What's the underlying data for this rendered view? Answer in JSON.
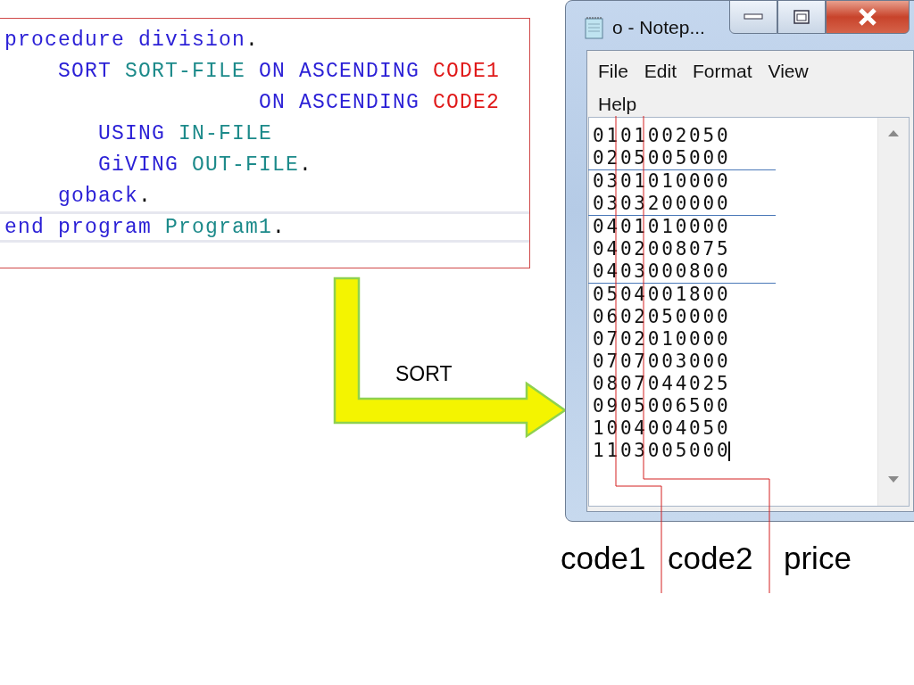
{
  "editor": {
    "lines": [
      {
        "current": false,
        "tokens": [
          {
            "kind": "keyword",
            "text": "procedure division"
          },
          {
            "kind": "punct",
            "text": "."
          }
        ]
      },
      {
        "current": false,
        "tokens": [
          {
            "kind": "keyword",
            "text": "    SORT "
          },
          {
            "kind": "identifier",
            "text": "SORT-FILE "
          },
          {
            "kind": "keyword",
            "text": "ON ASCENDING "
          },
          {
            "kind": "field",
            "text": "CODE1"
          }
        ]
      },
      {
        "current": false,
        "tokens": [
          {
            "kind": "keyword",
            "text": "                   ON ASCENDING "
          },
          {
            "kind": "field",
            "text": "CODE2"
          }
        ]
      },
      {
        "current": false,
        "tokens": [
          {
            "kind": "keyword",
            "text": "       USING "
          },
          {
            "kind": "identifier",
            "text": "IN-FILE"
          }
        ]
      },
      {
        "current": false,
        "tokens": [
          {
            "kind": "keyword",
            "text": "       GiVING "
          },
          {
            "kind": "identifier",
            "text": "OUT-FILE"
          },
          {
            "kind": "punct",
            "text": "."
          }
        ]
      },
      {
        "current": false,
        "tokens": [
          {
            "kind": "keyword",
            "text": "    goback"
          },
          {
            "kind": "punct",
            "text": "."
          }
        ]
      },
      {
        "current": true,
        "tokens": [
          {
            "kind": "keyword",
            "text": "end program "
          },
          {
            "kind": "identifier",
            "text": "Program1"
          },
          {
            "kind": "punct",
            "text": "."
          }
        ]
      }
    ]
  },
  "arrow_label": "SORT",
  "notepad": {
    "title": "o - Notep...",
    "menu": [
      "File",
      "Edit",
      "Format",
      "View",
      "Help"
    ],
    "rows": [
      {
        "text": "0101002050",
        "divider_below": false,
        "caret": false
      },
      {
        "text": "0205005000",
        "divider_below": true,
        "caret": false
      },
      {
        "text": "0301010000",
        "divider_below": false,
        "caret": false
      },
      {
        "text": "0303200000",
        "divider_below": true,
        "caret": false
      },
      {
        "text": "0401010000",
        "divider_below": false,
        "caret": false
      },
      {
        "text": "0402008075",
        "divider_below": false,
        "caret": false
      },
      {
        "text": "0403000800",
        "divider_below": true,
        "caret": false
      },
      {
        "text": "0504001800",
        "divider_below": false,
        "caret": false
      },
      {
        "text": "0602050000",
        "divider_below": false,
        "caret": false
      },
      {
        "text": "0702010000",
        "divider_below": false,
        "caret": false
      },
      {
        "text": "0707003000",
        "divider_below": false,
        "caret": false
      },
      {
        "text": "0807044025",
        "divider_below": false,
        "caret": false
      },
      {
        "text": "0905006500",
        "divider_below": false,
        "caret": false
      },
      {
        "text": "1004004050",
        "divider_below": false,
        "caret": false
      },
      {
        "text": "1103005000",
        "divider_below": false,
        "caret": true
      }
    ]
  },
  "column_labels": [
    "code1",
    "code2",
    "price"
  ]
}
